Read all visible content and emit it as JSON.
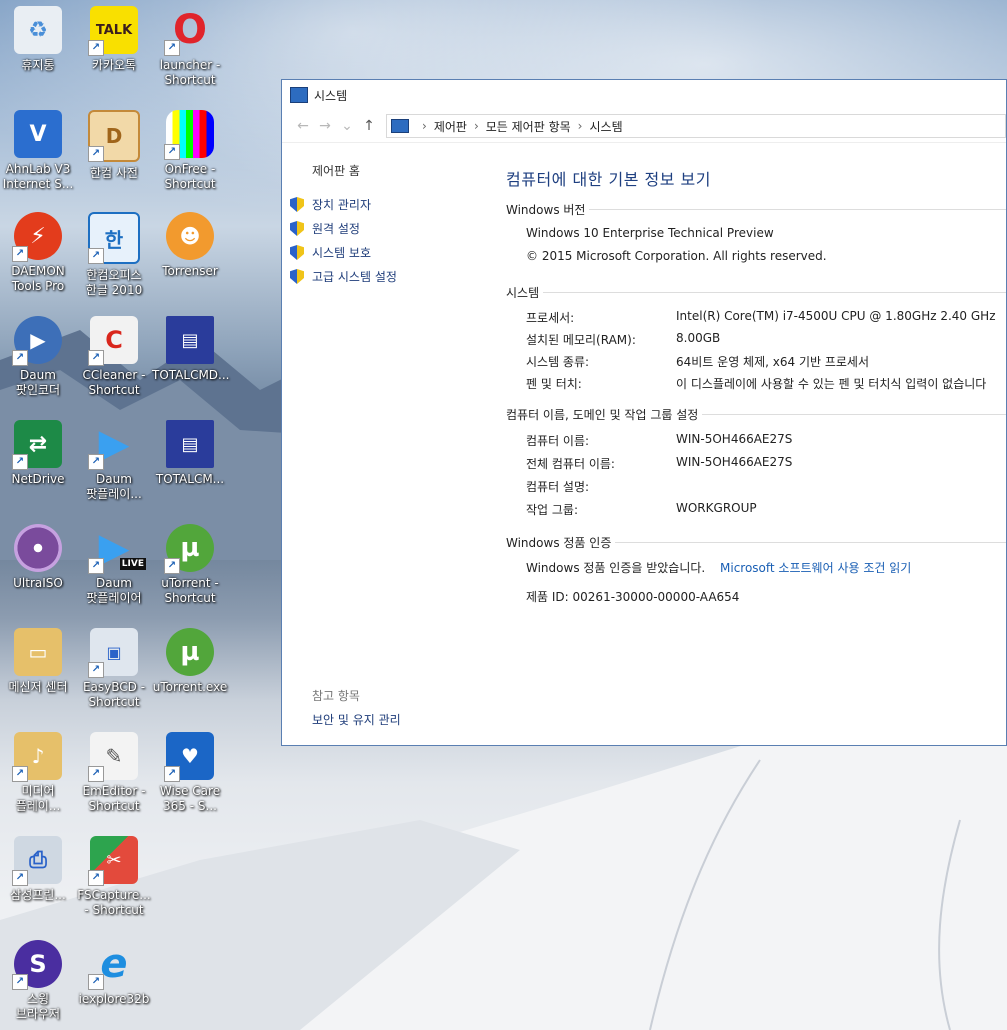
{
  "desktop": {
    "icons": [
      {
        "label": "휴지통"
      },
      {
        "label": "카카오톡"
      },
      {
        "label": "launcher -\nShortcut"
      },
      {
        "label": "AhnLab V3\nInternet S..."
      },
      {
        "label": "한컴 사전"
      },
      {
        "label": "OnFree -\nShortcut"
      },
      {
        "label": "DAEMON\nTools Pro"
      },
      {
        "label": "한컴오피스\n한글 2010"
      },
      {
        "label": "Torrenser"
      },
      {
        "label": "Daum\n팟인코더"
      },
      {
        "label": "CCleaner -\nShortcut"
      },
      {
        "label": "TOTALCMD..."
      },
      {
        "label": "NetDrive"
      },
      {
        "label": "Daum\n팟플레이..."
      },
      {
        "label": "TOTALCM..."
      },
      {
        "label": "UltraISO"
      },
      {
        "label": "Daum\n팟플레이어"
      },
      {
        "label": "uTorrent -\nShortcut"
      },
      {
        "label": "메신저 센터"
      },
      {
        "label": "EasyBCD -\nShortcut"
      },
      {
        "label": "uTorrent.exe"
      },
      {
        "label": "미디어\n플레이..."
      },
      {
        "label": "EmEditor -\nShortcut"
      },
      {
        "label": "Wise Care\n365 - S..."
      },
      {
        "label": "삼성프린..."
      },
      {
        "label": "FSCapture...\n- Shortcut"
      },
      {
        "label": "스윙\n브라우저"
      },
      {
        "label": "iexplore32b"
      }
    ],
    "badges": {
      "talk": "TALK",
      "live": "LIVE",
      "ie": "e",
      "kakao_color": "#f9e000"
    }
  },
  "window": {
    "title": "시스템",
    "nav": {
      "back": "←",
      "forward": "→",
      "dropdown": "⌄",
      "up": "↑"
    },
    "breadcrumb": [
      "제어판",
      "모든 제어판 항목",
      "시스템"
    ],
    "left": {
      "home": "제어판 홈",
      "tasks": [
        "장치 관리자",
        "원격 설정",
        "시스템 보호",
        "고급 시스템 설정"
      ],
      "see_also_title": "참고 항목",
      "see_also_item": "보안 및 유지 관리"
    },
    "main": {
      "heading": "컴퓨터에 대한 기본 정보 보기",
      "edition_title": "Windows 버전",
      "edition": "Windows 10 Enterprise Technical Preview",
      "copyright": "© 2015 Microsoft Corporation. All rights reserved.",
      "system_title": "시스템",
      "system_rows": [
        {
          "label": "프로세서:",
          "value": "Intel(R) Core(TM) i7-4500U CPU @ 1.80GHz   2.40 GHz"
        },
        {
          "label": "설치된 메모리(RAM):",
          "value": "8.00GB"
        },
        {
          "label": "시스템 종류:",
          "value": "64비트 운영 체제, x64 기반 프로세서"
        },
        {
          "label": "펜 및 터치:",
          "value": "이 디스플레이에 사용할 수 있는 펜 및 터치식 입력이 없습니다"
        }
      ],
      "computer_title": "컴퓨터 이름, 도메인 및 작업 그룹 설정",
      "computer_rows": [
        {
          "label": "컴퓨터 이름:",
          "value": "WIN-5OH466AE27S"
        },
        {
          "label": "전체 컴퓨터 이름:",
          "value": "WIN-5OH466AE27S"
        },
        {
          "label": "컴퓨터 설명:",
          "value": ""
        },
        {
          "label": "작업 그룹:",
          "value": "WORKGROUP"
        }
      ],
      "activation_title": "Windows 정품 인증",
      "activation_status": "Windows 정품 인증을 받았습니다.",
      "activation_link": "Microsoft 소프트웨어 사용 조건 읽기",
      "product_id": "제품 ID: 00261-30000-00000-AA654"
    }
  }
}
